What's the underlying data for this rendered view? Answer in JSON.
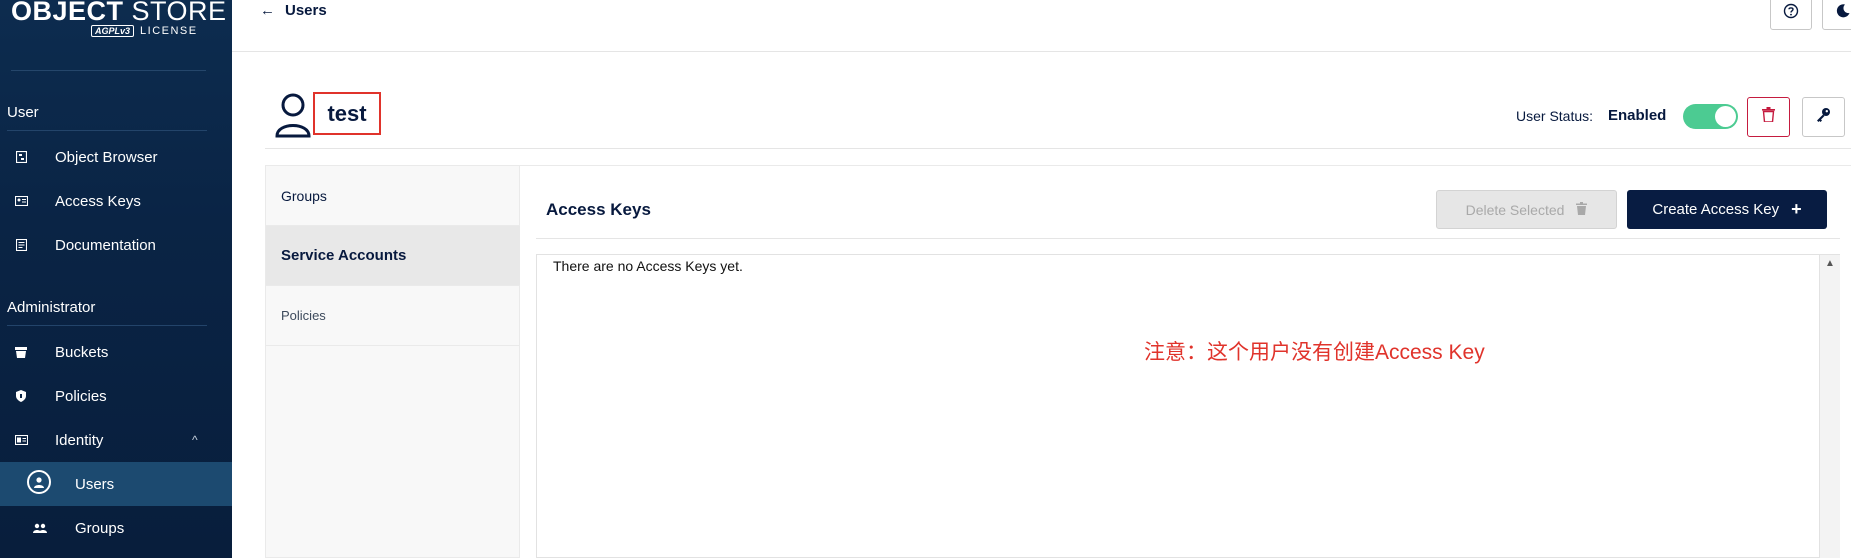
{
  "brand": {
    "title_bold": "OBJECT",
    "title_light": "STORE",
    "license_badge": "AGPLv3",
    "license_text": "LICENSE"
  },
  "sidebar": {
    "user_section": "User",
    "user_items": [
      {
        "label": "Object Browser",
        "icon": "folder-icon"
      },
      {
        "label": "Access Keys",
        "icon": "id-card-icon"
      },
      {
        "label": "Documentation",
        "icon": "document-icon"
      }
    ],
    "admin_section": "Administrator",
    "admin_items": [
      {
        "label": "Buckets",
        "icon": "bucket-icon"
      },
      {
        "label": "Policies",
        "icon": "shield-icon"
      },
      {
        "label": "Identity",
        "icon": "id-badge-icon"
      },
      {
        "label": "Users",
        "icon": "user-circle-icon"
      },
      {
        "label": "Groups",
        "icon": "group-icon"
      }
    ]
  },
  "topbar": {
    "back_label": "Users",
    "back_arrow": "←"
  },
  "user": {
    "name": "test",
    "status_label": "User Status:",
    "status_value": "Enabled",
    "enabled": true
  },
  "tabs": [
    {
      "label": "Groups"
    },
    {
      "label": "Service Accounts"
    },
    {
      "label": "Policies"
    }
  ],
  "panel": {
    "title": "Access Keys",
    "delete_button": "Delete Selected",
    "create_button": "Create Access Key",
    "empty_message": "There are no Access Keys yet."
  },
  "annotation": {
    "text": "注意：这个用户没有创建Access Key",
    "color": "#e0332b"
  },
  "colors": {
    "sidebar": "#0a2445",
    "accent": "#081c42",
    "toggle_on": "#4ccb92",
    "danger": "#c51b3f"
  }
}
